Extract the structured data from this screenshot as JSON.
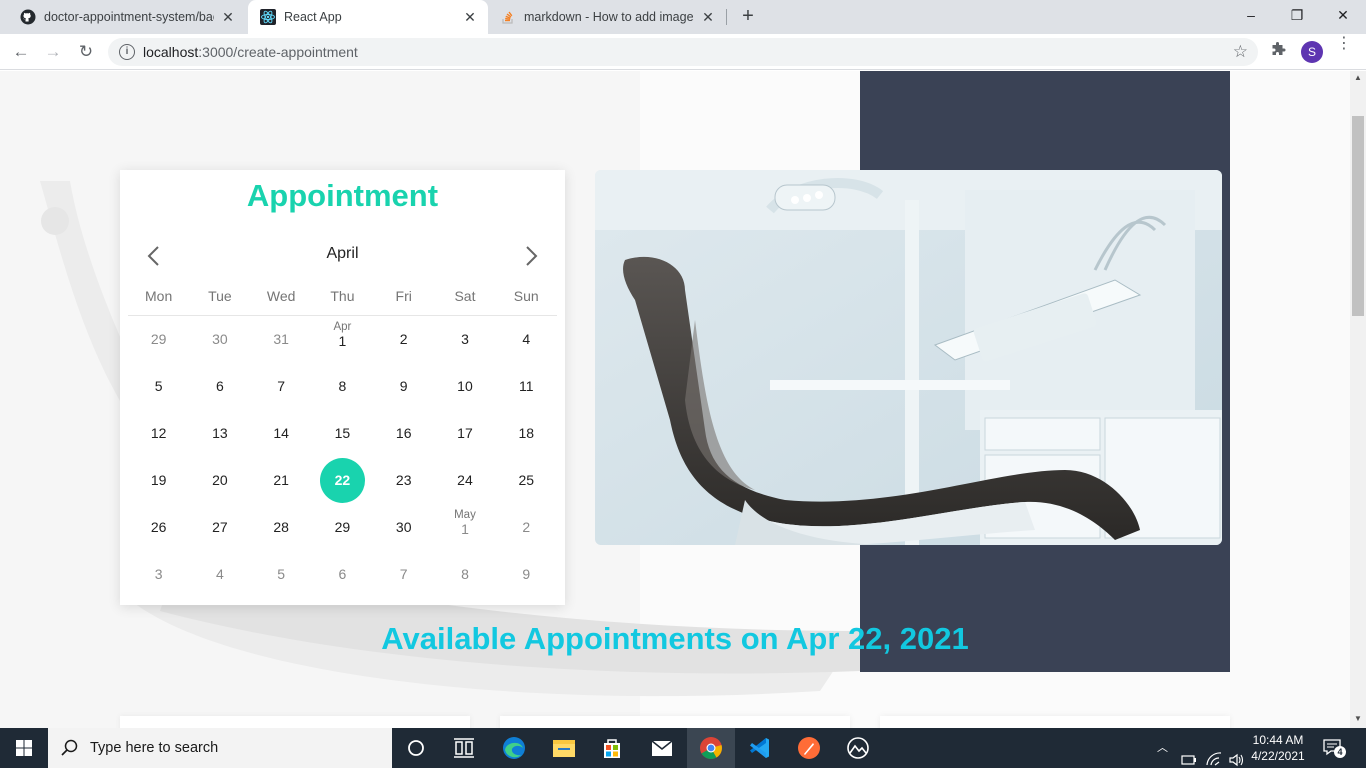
{
  "browser": {
    "tabs": [
      {
        "title": "doctor-appointment-system/bac",
        "icon": "github-icon",
        "active": false
      },
      {
        "title": "React App",
        "icon": "react-icon",
        "active": true
      },
      {
        "title": "markdown - How to add images",
        "icon": "stackoverflow-icon",
        "active": false
      }
    ],
    "new_tab": "+",
    "url_host": "localhost",
    "url_rest": ":3000/create-appointment",
    "profile_initial": "S",
    "window_controls": {
      "minimize": "–",
      "restore": "❐",
      "close": "✕"
    }
  },
  "calendar": {
    "heading": "Appointment",
    "month": "April",
    "weekdays": [
      "Mon",
      "Tue",
      "Wed",
      "Thu",
      "Fri",
      "Sat",
      "Sun"
    ],
    "weeks": [
      [
        {
          "d": "29",
          "o": true
        },
        {
          "d": "30",
          "o": true
        },
        {
          "d": "31",
          "o": true
        },
        {
          "d": "1",
          "l": "Apr"
        },
        {
          "d": "2"
        },
        {
          "d": "3"
        },
        {
          "d": "4"
        }
      ],
      [
        {
          "d": "5"
        },
        {
          "d": "6"
        },
        {
          "d": "7"
        },
        {
          "d": "8"
        },
        {
          "d": "9"
        },
        {
          "d": "10"
        },
        {
          "d": "11"
        }
      ],
      [
        {
          "d": "12"
        },
        {
          "d": "13"
        },
        {
          "d": "14"
        },
        {
          "d": "15"
        },
        {
          "d": "16"
        },
        {
          "d": "17"
        },
        {
          "d": "18"
        }
      ],
      [
        {
          "d": "19"
        },
        {
          "d": "20"
        },
        {
          "d": "21"
        },
        {
          "d": "22",
          "s": true
        },
        {
          "d": "23"
        },
        {
          "d": "24"
        },
        {
          "d": "25"
        }
      ],
      [
        {
          "d": "26"
        },
        {
          "d": "27"
        },
        {
          "d": "28"
        },
        {
          "d": "29"
        },
        {
          "d": "30"
        },
        {
          "d": "1",
          "l": "May",
          "o": true
        },
        {
          "d": "2",
          "o": true
        }
      ],
      [
        {
          "d": "3",
          "o": true
        },
        {
          "d": "4",
          "o": true
        },
        {
          "d": "5",
          "o": true
        },
        {
          "d": "6",
          "o": true
        },
        {
          "d": "7",
          "o": true
        },
        {
          "d": "8",
          "o": true
        },
        {
          "d": "9",
          "o": true
        }
      ]
    ],
    "accent_color": "#19d3ae"
  },
  "available_heading": "Available Appointments on Apr 22, 2021",
  "colors": {
    "panel": "#3a4255",
    "headline": "#12c8e0"
  },
  "taskbar": {
    "search_placeholder": "Type here to search",
    "time": "10:44 AM",
    "date": "4/22/2021",
    "notification_count": "4"
  }
}
